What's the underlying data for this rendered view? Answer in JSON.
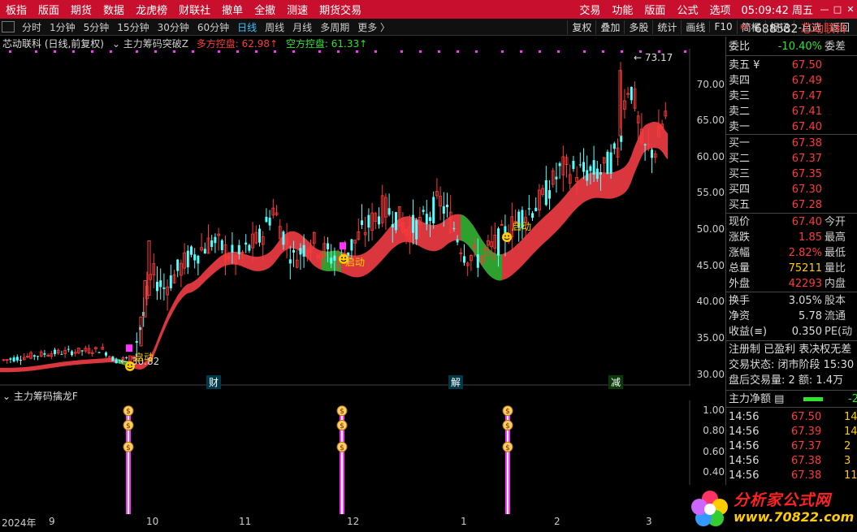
{
  "menubar": {
    "items": [
      "板指",
      "版面",
      "期货",
      "数据",
      "龙虎榜",
      "财联社",
      "撤单",
      "全撤",
      "测速",
      "期货交易"
    ],
    "right_items": [
      "交易",
      "功能",
      "版面",
      "公式",
      "选项"
    ],
    "clock": "05:09:42 周五"
  },
  "periodbar": {
    "periods": [
      "分时",
      "1分钟",
      "5分钟",
      "15分钟",
      "30分钟",
      "60分钟",
      "日线",
      "周线",
      "月线",
      "多周期",
      "更多 〉"
    ],
    "active": "日线",
    "tools": [
      "复权",
      "叠加",
      "多股",
      "统计",
      "画线",
      "F10",
      "简框",
      "标记",
      "-自选",
      "返回"
    ]
  },
  "chart_title": {
    "stock": "芯动联科 (日线,前复权)",
    "indicator": "主力筹码突破Z",
    "bull_label": "多方控盘: 62.98↑",
    "bear_label": "空方控盘: 61.33↑"
  },
  "annotations": {
    "high": "73.17",
    "low": "30.82",
    "launch": "启动"
  },
  "events": [
    "财",
    "解",
    "减"
  ],
  "sub_title": "主力筹码擒龙F",
  "quote": {
    "code": "688582",
    "name": "芯动联科",
    "ratio_label": "委比",
    "ratio_value": "-10.40%",
    "ratio_diff": "委差",
    "asks": [
      {
        "label": "卖五 ¥",
        "price": "67.50"
      },
      {
        "label": "卖四",
        "price": "67.49"
      },
      {
        "label": "卖三",
        "price": "67.47"
      },
      {
        "label": "卖二",
        "price": "67.41"
      },
      {
        "label": "卖一",
        "price": "67.40"
      }
    ],
    "bids": [
      {
        "label": "买一",
        "price": "67.38"
      },
      {
        "label": "买二",
        "price": "67.37"
      },
      {
        "label": "买三",
        "price": "67.35"
      },
      {
        "label": "买四",
        "price": "67.30"
      },
      {
        "label": "买五",
        "price": "67.28"
      }
    ],
    "stats": [
      {
        "label": "现价",
        "value": "67.40",
        "label2": "今开"
      },
      {
        "label": "涨跌",
        "value": "1.85",
        "label2": "最高"
      },
      {
        "label": "涨幅",
        "value": "2.82%",
        "label2": "最低"
      },
      {
        "label": "总量",
        "value": "75211",
        "label2": "量比"
      },
      {
        "label": "外盘",
        "value": "42293",
        "label2": "内盘"
      }
    ],
    "stats2": [
      {
        "label": "换手",
        "value": "3.05%",
        "label2": "股本"
      },
      {
        "label": "净资",
        "value": "5.78",
        "label2": "流通"
      },
      {
        "label": "收益(≡)",
        "value": "0.350",
        "label2": "PE(动"
      }
    ],
    "info_line": "注册制 已盈利 表决权无差",
    "status_line": "交易状态: 闭市阶段 15:30",
    "after_line": "盘后交易量: 2  额: 1.4万",
    "net_label": "主力净额",
    "net_value": "-2",
    "ticks": [
      {
        "time": "14:56",
        "price": "67.50",
        "vol": "14"
      },
      {
        "time": "14:56",
        "price": "67.39",
        "vol": "14"
      },
      {
        "time": "14:56",
        "price": "67.37",
        "vol": "2"
      },
      {
        "time": "14:56",
        "price": "67.38",
        "vol": "3"
      },
      {
        "time": "14:56",
        "price": "67.38",
        "vol": "11"
      }
    ]
  },
  "main_yaxis": [
    "70.00",
    "65.00",
    "60.00",
    "55.00",
    "50.00",
    "45.00",
    "40.00",
    "35.00",
    "30.00"
  ],
  "sub_yaxis": [
    "1.00",
    "0.80",
    "0.60",
    "0.40"
  ],
  "dates": [
    "2024年",
    "9",
    "10",
    "11",
    "12",
    "1",
    "2",
    "3"
  ],
  "logo": {
    "title": "分析家公式网",
    "url": "www.70822.com"
  },
  "colors": {
    "up": "#ff3a3a",
    "down": "#54ffff",
    "band": "#d9363e",
    "band_green": "#2da02d",
    "menubar": "#c8102e",
    "signal": "#ff33ff"
  },
  "chart_data": {
    "type": "candlestick",
    "y_range": [
      28.5,
      75
    ],
    "high_point": 73.17,
    "low_point": 30.82,
    "series_hint": "daily candles from Aug 2024 to Mar 2025, rising from ~31 to ~67"
  }
}
